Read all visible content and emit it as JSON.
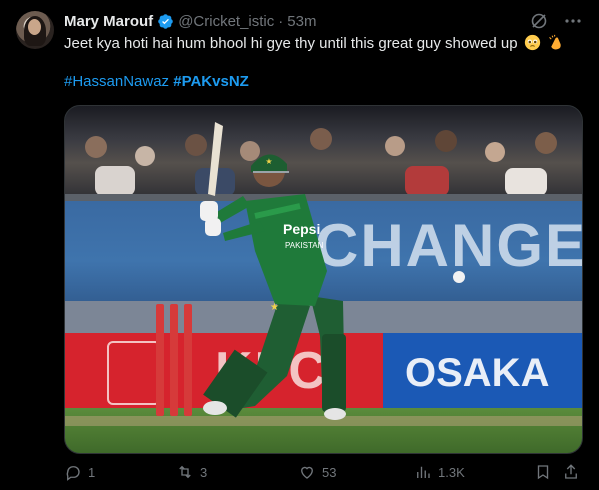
{
  "author": {
    "name": "Mary Marouf",
    "handle": "@Cricket_istic",
    "time": "53m",
    "separator": "·"
  },
  "tweet": {
    "text": "Jeet kya hoti hai hum bhool hi gye thy until this great guy showed up",
    "emojis": [
      "pleading-face",
      "clapping-hands"
    ],
    "hashtags": [
      {
        "text": "#HassanNawaz",
        "bold": false
      },
      {
        "text": "#PAKvsNZ",
        "bold": true
      }
    ]
  },
  "media": {
    "billboard_text": "CHANGE",
    "ad_left_text": "KFC",
    "ad_right_text": "OSAKA",
    "jersey_text": "Pepsi",
    "jersey_country": "PAKISTAN"
  },
  "actions": {
    "reply_count": "1",
    "repost_count": "3",
    "like_count": "53",
    "views_count": "1.3K"
  },
  "colors": {
    "background": "#000000",
    "text": "#e7e9ea",
    "muted": "#71767b",
    "accent": "#1d9bf0"
  },
  "icons": [
    "grok-icon",
    "more-icon",
    "verified-badge-icon",
    "reply-icon",
    "repost-icon",
    "like-icon",
    "views-icon",
    "bookmark-icon",
    "share-icon"
  ]
}
